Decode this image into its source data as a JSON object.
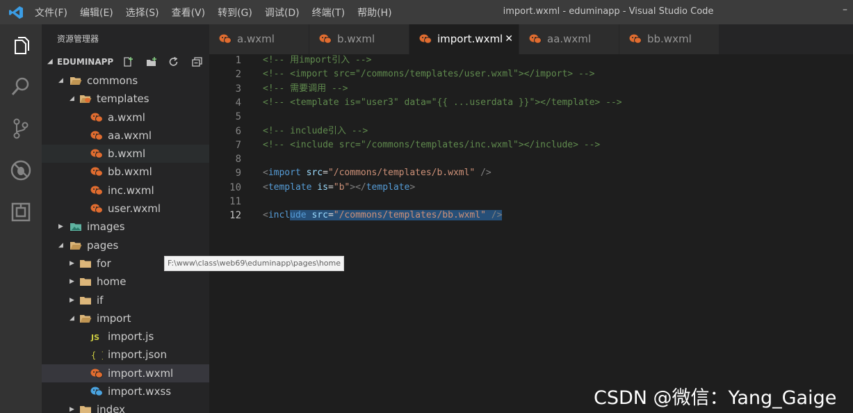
{
  "window": {
    "title": "import.wxml - eduminapp - Visual Studio Code",
    "menu": [
      "文件(F)",
      "编辑(E)",
      "选择(S)",
      "查看(V)",
      "转到(G)",
      "调试(D)",
      "终端(T)",
      "帮助(H)"
    ],
    "right_glyph": "–"
  },
  "colors": {
    "accent": "#007acc",
    "wx_icon": "#e06c2f",
    "wxss_icon": "#4aa3df",
    "selection": "#264f78"
  },
  "activity_bar": [
    {
      "name": "explorer-icon"
    },
    {
      "name": "search-icon"
    },
    {
      "name": "source-control-icon"
    },
    {
      "name": "debug-icon"
    },
    {
      "name": "extensions-icon"
    }
  ],
  "sidebar": {
    "title": "资源管理器",
    "section": "EDUMINAPP",
    "tree": [
      {
        "label": "commons",
        "depth": 0,
        "twisty": "open",
        "icon": "folder-open"
      },
      {
        "label": "templates",
        "depth": 1,
        "twisty": "open",
        "icon": "folder-open-wx"
      },
      {
        "label": "a.wxml",
        "depth": 2,
        "twisty": "",
        "icon": "wx"
      },
      {
        "label": "aa.wxml",
        "depth": 2,
        "twisty": "",
        "icon": "wx"
      },
      {
        "label": "b.wxml",
        "depth": 2,
        "twisty": "",
        "icon": "wx",
        "state": "hover"
      },
      {
        "label": "bb.wxml",
        "depth": 2,
        "twisty": "",
        "icon": "wx"
      },
      {
        "label": "inc.wxml",
        "depth": 2,
        "twisty": "",
        "icon": "wx"
      },
      {
        "label": "user.wxml",
        "depth": 2,
        "twisty": "",
        "icon": "wx"
      },
      {
        "label": "images",
        "depth": 0,
        "twisty": "closed",
        "icon": "images"
      },
      {
        "label": "pages",
        "depth": 0,
        "twisty": "open",
        "icon": "folder-open"
      },
      {
        "label": "for",
        "depth": 1,
        "twisty": "closed",
        "icon": "folder"
      },
      {
        "label": "home",
        "depth": 1,
        "twisty": "closed",
        "icon": "folder"
      },
      {
        "label": "if",
        "depth": 1,
        "twisty": "closed",
        "icon": "folder"
      },
      {
        "label": "import",
        "depth": 1,
        "twisty": "open",
        "icon": "folder-open"
      },
      {
        "label": "import.js",
        "depth": 2,
        "twisty": "",
        "icon": "js"
      },
      {
        "label": "import.json",
        "depth": 2,
        "twisty": "",
        "icon": "json"
      },
      {
        "label": "import.wxml",
        "depth": 2,
        "twisty": "",
        "icon": "wx",
        "state": "selected"
      },
      {
        "label": "import.wxss",
        "depth": 2,
        "twisty": "",
        "icon": "wxss"
      },
      {
        "label": "index",
        "depth": 1,
        "twisty": "closed",
        "icon": "folder"
      }
    ],
    "tooltip": "F:\\www\\class\\web69\\eduminapp\\pages\\home"
  },
  "tabs": [
    {
      "label": "a.wxml",
      "active": false
    },
    {
      "label": "b.wxml",
      "active": false
    },
    {
      "label": "import.wxml",
      "active": true,
      "close": "✕"
    },
    {
      "label": "aa.wxml",
      "active": false
    },
    {
      "label": "bb.wxml",
      "active": false
    }
  ],
  "editor": {
    "current_line": 12,
    "lines": [
      {
        "n": "1",
        "tokens": [
          [
            "c-comment",
            "<!-- 用import引入 -->"
          ]
        ]
      },
      {
        "n": "2",
        "tokens": [
          [
            "c-comment",
            "<!-- <import src=\"/commons/templates/user.wxml\"></import> -->"
          ]
        ]
      },
      {
        "n": "3",
        "tokens": [
          [
            "c-comment",
            "<!-- 需要调用 -->"
          ]
        ]
      },
      {
        "n": "4",
        "tokens": [
          [
            "c-comment",
            "<!-- <template is=\"user3\" data=\"{{ ...userdata }}\"></template> -->"
          ]
        ]
      },
      {
        "n": "5",
        "tokens": []
      },
      {
        "n": "6",
        "tokens": [
          [
            "c-comment",
            "<!-- include引入 -->"
          ]
        ]
      },
      {
        "n": "7",
        "tokens": [
          [
            "c-comment",
            "<!-- <include src=\"/commons/templates/inc.wxml\"></include> -->"
          ]
        ]
      },
      {
        "n": "8",
        "tokens": []
      },
      {
        "n": "9",
        "tokens": [
          [
            "c-punct",
            "<"
          ],
          [
            "c-tag",
            "import"
          ],
          [
            "c-text",
            " "
          ],
          [
            "c-attr",
            "src"
          ],
          [
            "c-text",
            "="
          ],
          [
            "c-str",
            "\"/commons/templates/b.wxml\""
          ],
          [
            "c-text",
            " "
          ],
          [
            "c-punct",
            "/>"
          ]
        ]
      },
      {
        "n": "10",
        "tokens": [
          [
            "c-punct",
            "<"
          ],
          [
            "c-tag",
            "template"
          ],
          [
            "c-text",
            " "
          ],
          [
            "c-attr",
            "is"
          ],
          [
            "c-text",
            "="
          ],
          [
            "c-str",
            "\"b\""
          ],
          [
            "c-punct",
            "></"
          ],
          [
            "c-tag",
            "template"
          ],
          [
            "c-punct",
            ">"
          ]
        ]
      },
      {
        "n": "11",
        "tokens": []
      },
      {
        "n": "12",
        "tokens": [
          [
            "c-punct",
            "<"
          ],
          [
            "c-tag",
            "incl"
          ],
          [
            "c-tag sel-bg",
            "ude"
          ],
          [
            "c-text sel-bg",
            " "
          ],
          [
            "c-attr sel-bg",
            "src"
          ],
          [
            "c-text sel-bg",
            "="
          ],
          [
            "c-str sel-bg",
            "\"/commons/templates/bb.wxml\""
          ],
          [
            "c-text sel-bg",
            " "
          ],
          [
            "c-punct sel-bg",
            "/>"
          ]
        ]
      }
    ]
  },
  "watermark": "CSDN @微信：Yang_Gaige"
}
